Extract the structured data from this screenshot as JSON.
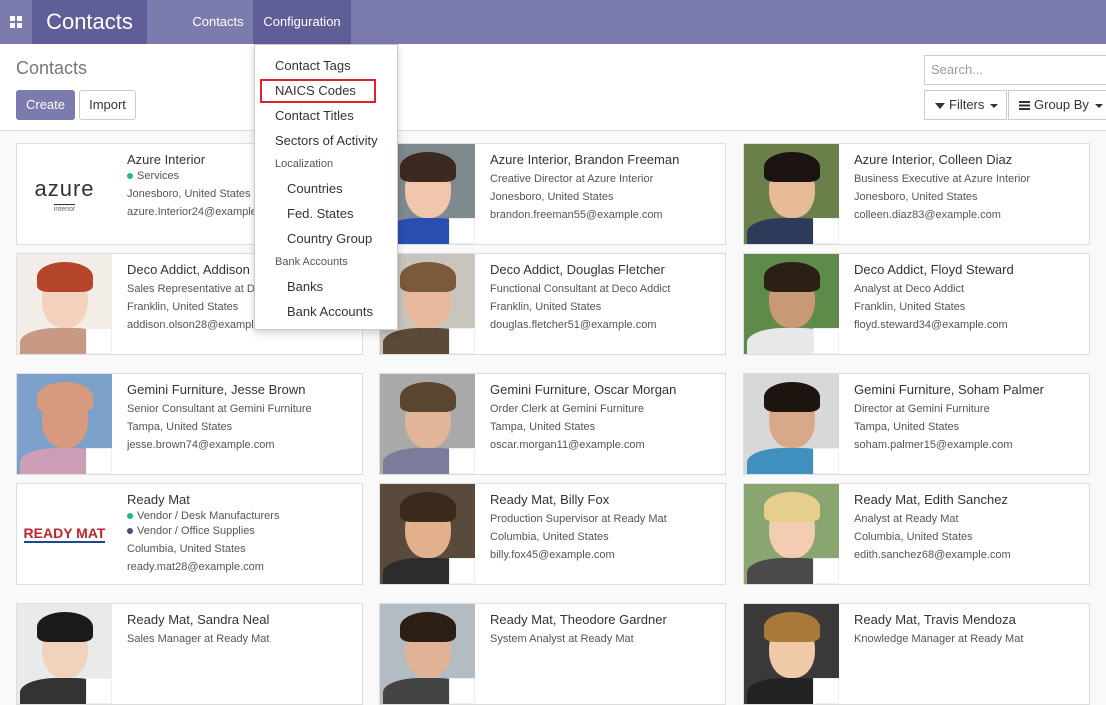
{
  "topbar": {
    "brand": "Contacts",
    "menu": [
      "Contacts",
      "Configuration"
    ]
  },
  "control_panel": {
    "title": "Contacts",
    "create_label": "Create",
    "import_label": "Import",
    "search_placeholder": "Search...",
    "filters_label": "Filters",
    "groupby_label": "Group By"
  },
  "dropdown": {
    "items": {
      "contact_tags": "Contact Tags",
      "naics_codes": "NAICS Codes",
      "contact_titles": "Contact Titles",
      "sectors": "Sectors of Activity",
      "localization_header": "Localization",
      "countries": "Countries",
      "fed_states": "Fed. States",
      "country_group": "Country Group",
      "bank_accounts_header": "Bank Accounts",
      "banks": "Banks",
      "bank_accounts": "Bank Accounts"
    }
  },
  "colors": {
    "navbar": "#7c7bad",
    "navbar_active": "#5f5e97",
    "highlight": "#e0202a",
    "tag_green": "#21b799",
    "tag_dark": "#4c4c6d"
  },
  "cards": [
    {
      "name": "Azure Interior",
      "tags": [
        "Services"
      ],
      "lines": [
        "Jonesboro, United States",
        "azure.Interior24@example.com"
      ]
    },
    {
      "name": "Azure Interior, Brandon Freeman",
      "lines": [
        "Creative Director at Azure Interior",
        "Jonesboro, United States",
        "brandon.freeman55@example.com"
      ]
    },
    {
      "name": "Azure Interior, Colleen Diaz",
      "lines": [
        "Business Executive at Azure Interior",
        "Jonesboro, United States",
        "colleen.diaz83@example.com"
      ]
    },
    {
      "name": "Deco Addict, Addison Olson",
      "lines": [
        "Sales Representative at Deco Addict",
        "Franklin, United States",
        "addison.olson28@example.com"
      ]
    },
    {
      "name": "Deco Addict, Douglas Fletcher",
      "lines": [
        "Functional Consultant at Deco Addict",
        "Franklin, United States",
        "douglas.fletcher51@example.com"
      ]
    },
    {
      "name": "Deco Addict, Floyd Steward",
      "lines": [
        "Analyst at Deco Addict",
        "Franklin, United States",
        "floyd.steward34@example.com"
      ]
    },
    {
      "name": "Gemini Furniture, Jesse Brown",
      "lines": [
        "Senior Consultant at Gemini Furniture",
        "Tampa, United States",
        "jesse.brown74@example.com"
      ]
    },
    {
      "name": "Gemini Furniture, Oscar Morgan",
      "lines": [
        "Order Clerk at Gemini Furniture",
        "Tampa, United States",
        "oscar.morgan11@example.com"
      ]
    },
    {
      "name": "Gemini Furniture, Soham Palmer",
      "lines": [
        "Director at Gemini Furniture",
        "Tampa, United States",
        "soham.palmer15@example.com"
      ]
    },
    {
      "name": "Ready Mat",
      "tags": [
        "Vendor / Desk Manufacturers",
        "Vendor / Office Supplies"
      ],
      "lines": [
        "Columbia, United States",
        "ready.mat28@example.com"
      ]
    },
    {
      "name": "Ready Mat, Billy Fox",
      "lines": [
        "Production Supervisor at Ready Mat",
        "Columbia, United States",
        "billy.fox45@example.com"
      ]
    },
    {
      "name": "Ready Mat, Edith Sanchez",
      "lines": [
        "Analyst at Ready Mat",
        "Columbia, United States",
        "edith.sanchez68@example.com"
      ]
    },
    {
      "name": "Ready Mat, Sandra Neal",
      "lines": [
        "Sales Manager at Ready Mat"
      ]
    },
    {
      "name": "Ready Mat, Theodore Gardner",
      "lines": [
        "System Analyst at Ready Mat"
      ]
    },
    {
      "name": "Ready Mat, Travis Mendoza",
      "lines": [
        "Knowledge Manager at Ready Mat"
      ]
    }
  ],
  "logos": {
    "azure_main": "azure",
    "azure_sub": "interior",
    "ready_mat": "READY MAT"
  }
}
